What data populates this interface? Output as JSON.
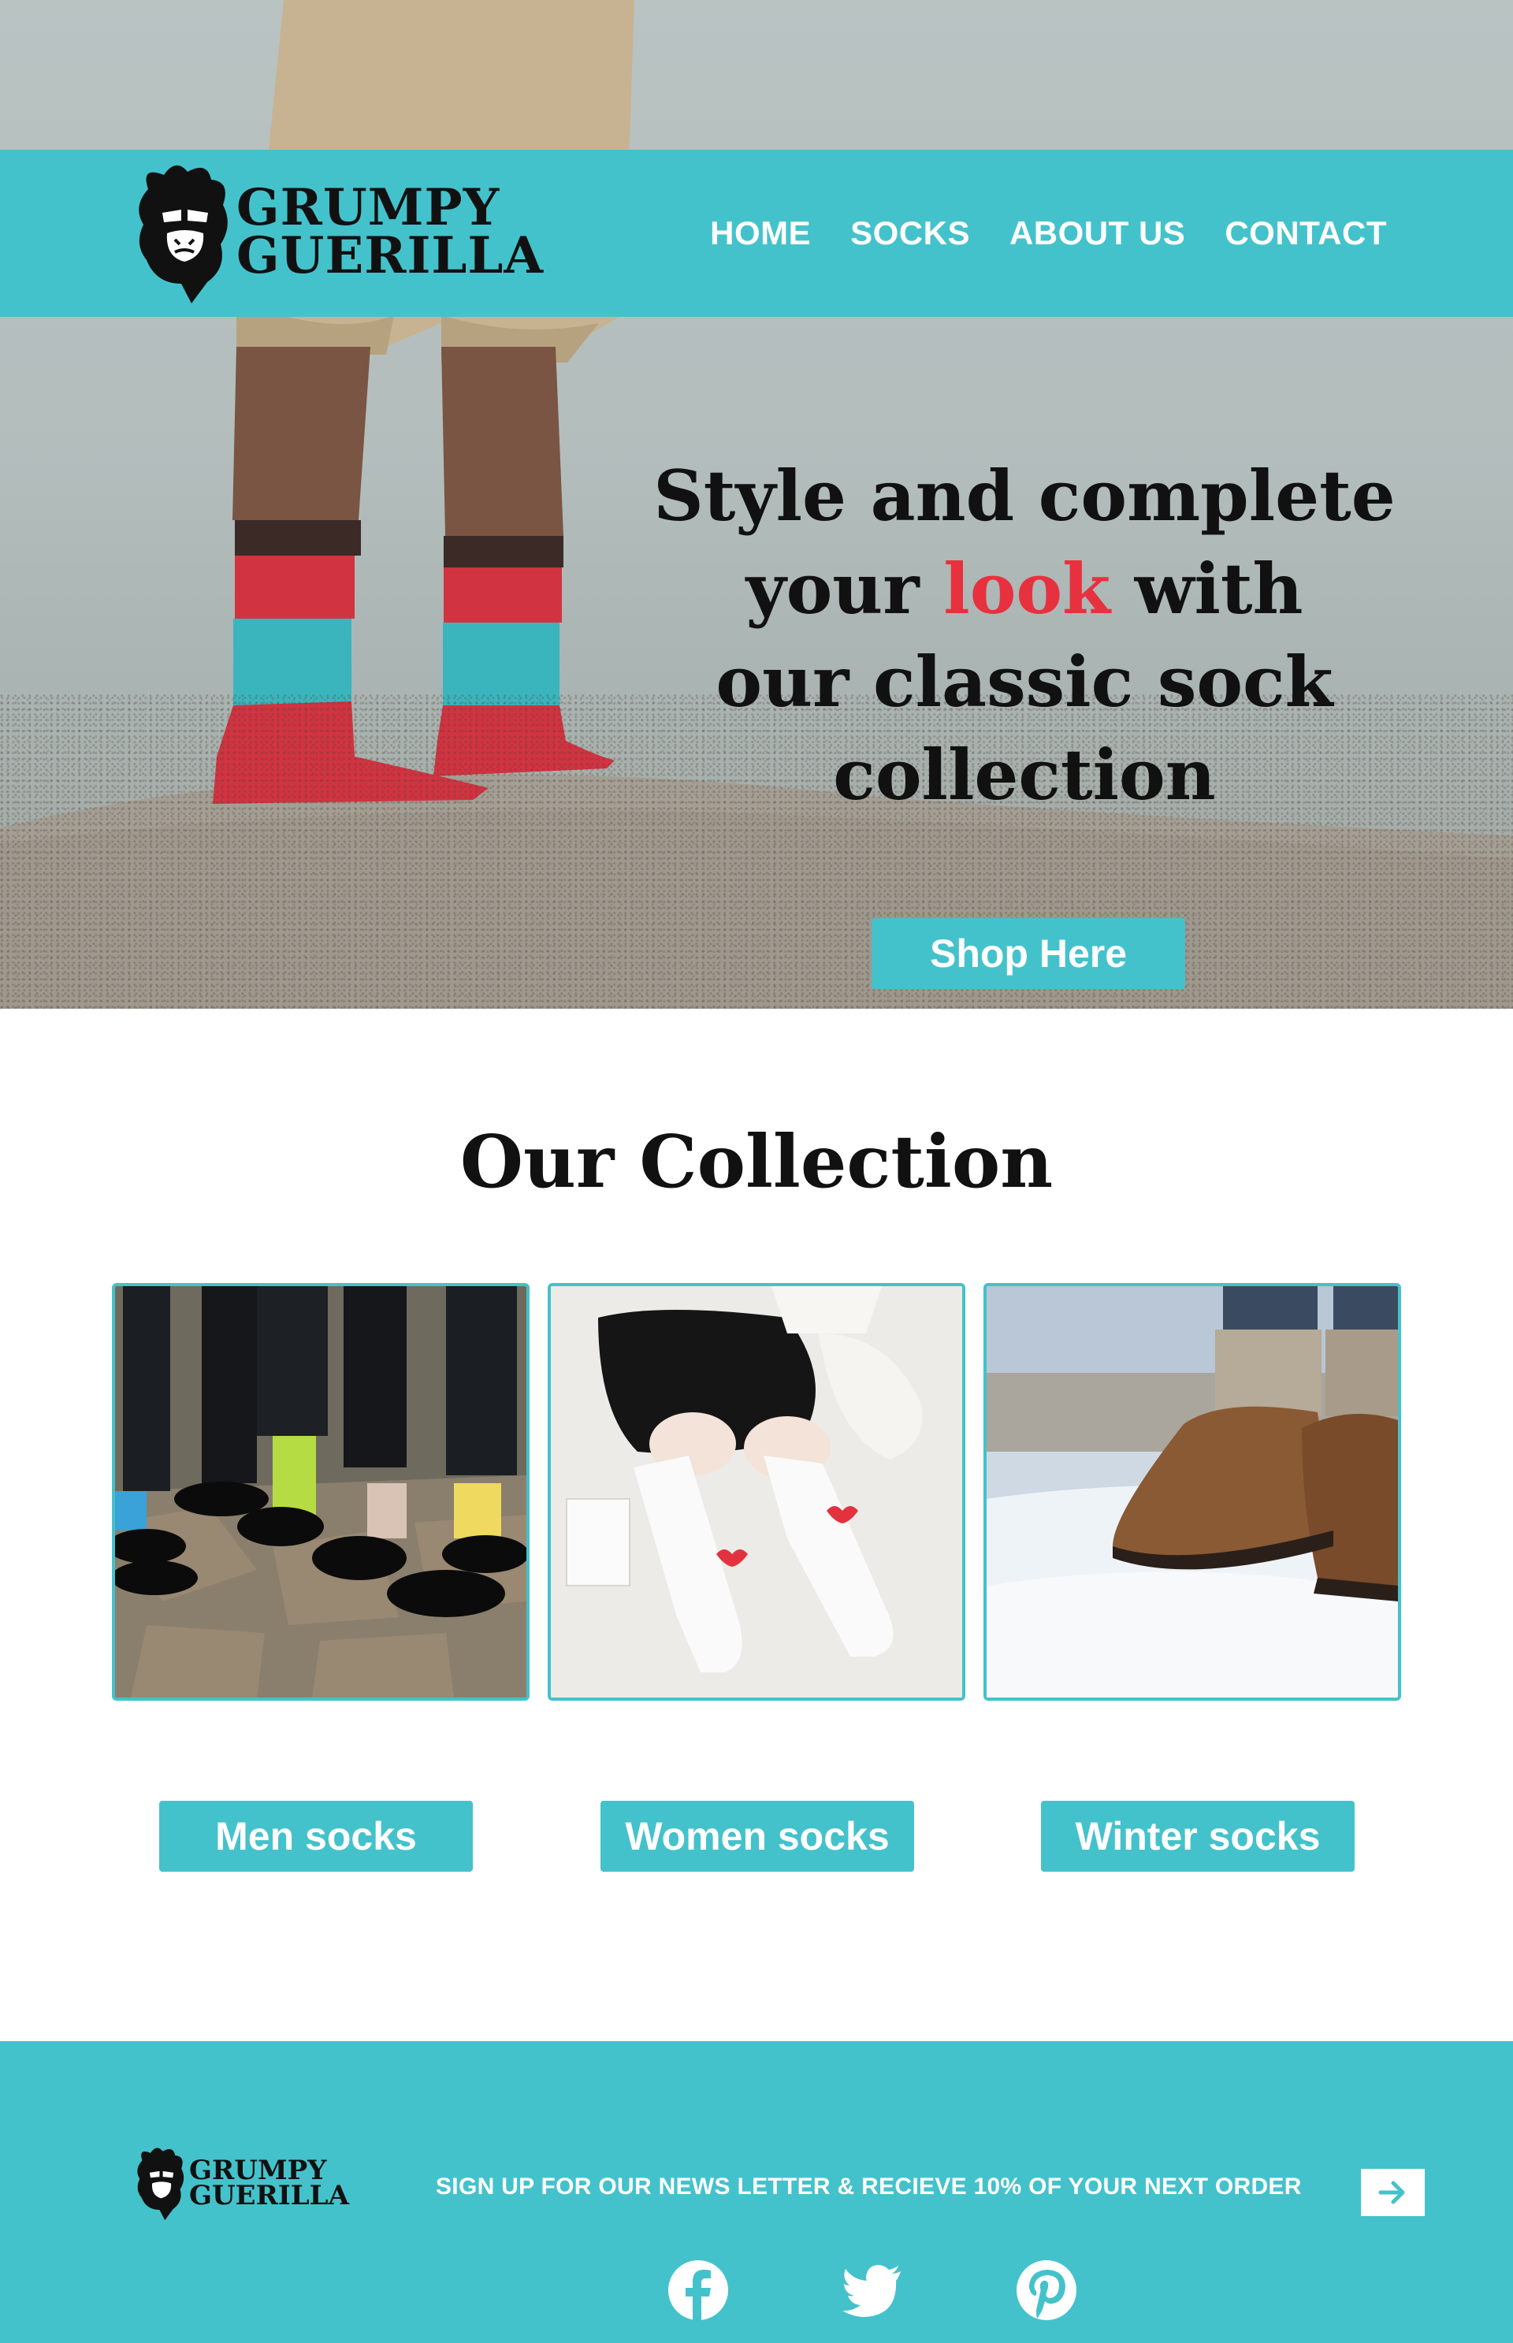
{
  "brand": {
    "name_line1": "GRUMPY",
    "name_line2": "GUERILLA"
  },
  "nav": {
    "items": [
      {
        "label": "HOME"
      },
      {
        "label": "SOCKS"
      },
      {
        "label": "ABOUT US"
      },
      {
        "label": "CONTACT"
      }
    ]
  },
  "hero": {
    "line1": "Style and complete",
    "line2_before": "your ",
    "line2_accent": "look",
    "line2_after": " with",
    "line3": "our classic sock",
    "line4": "collection",
    "cta_label": "Shop Here"
  },
  "collection": {
    "title": "Our Collection",
    "categories": [
      {
        "label": "Men socks",
        "image": "men-socks-photo"
      },
      {
        "label": "Women socks",
        "image": "women-socks-photo"
      },
      {
        "label": "Winter socks",
        "image": "winter-socks-photo"
      }
    ]
  },
  "footer": {
    "newsletter_text": "SIGN UP FOR OUR NEWS LETTER & RECIEVE 10% OF YOUR NEXT ORDER",
    "submit_icon": "arrow-right-icon",
    "social": [
      "facebook-icon",
      "twitter-icon",
      "pinterest-icon"
    ]
  },
  "colors": {
    "accent": "#44c2cb",
    "highlight": "#e8313e",
    "text": "#111111",
    "white": "#ffffff"
  }
}
